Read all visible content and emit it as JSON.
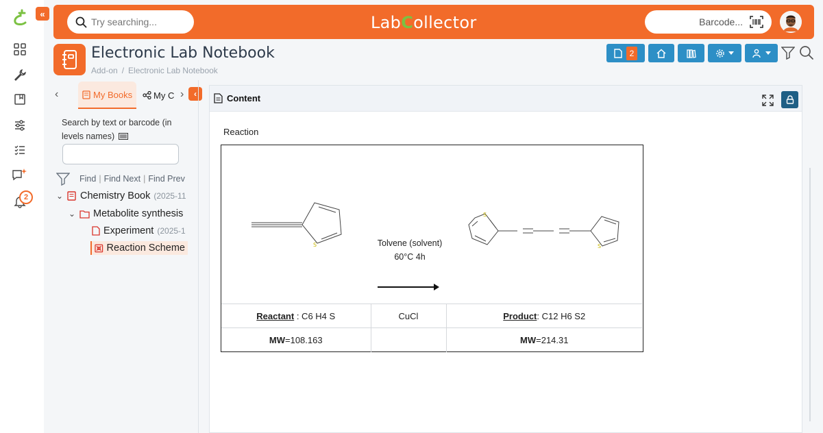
{
  "topbar": {
    "search_placeholder": "Try searching...",
    "brand_pre": "Lab",
    "brand_c": "C",
    "brand_post": "ollector",
    "barcode_label": "Barcode..."
  },
  "rail": {
    "notification_count": "2"
  },
  "page": {
    "title": "Electronic Lab Notebook",
    "breadcrumb": [
      "Add-on",
      "Electronic Lab Notebook"
    ]
  },
  "toolbar": {
    "docs_count": "2"
  },
  "tree": {
    "tabs": [
      "My Books",
      "My C"
    ],
    "search_label": "Search by text or barcode (in levels names)",
    "find": [
      "Find",
      "Find Next",
      "Find Prev"
    ],
    "nodes": [
      {
        "label": "Chemistry Book",
        "date": "(2025-11"
      },
      {
        "label": "Metabolite synthesis",
        "date": ""
      },
      {
        "label": "Experiment",
        "date": "(2025-1"
      },
      {
        "label": "Reaction Scheme",
        "date": ""
      }
    ]
  },
  "content": {
    "header": "Content",
    "section": "Reaction",
    "conditions": [
      "Tolvene (solvent)",
      "60°C 4h"
    ],
    "table": {
      "reactant_label": "Reactant",
      "reactant_formula": " : C6 H4 S",
      "catalyst": "CuCl",
      "product_label": "Product",
      "product_formula": ": C12 H6 S2",
      "mw_label": "MW",
      "reactant_mw": "=108.163",
      "product_mw": "=214.31"
    },
    "atom_label": "S"
  },
  "colors": {
    "accent": "#f26b2a",
    "brand_green": "#7bc142",
    "tool_blue": "#2d8fc6",
    "lock_blue": "#1f5f85",
    "sulfur_yellow": "#c9b800"
  }
}
